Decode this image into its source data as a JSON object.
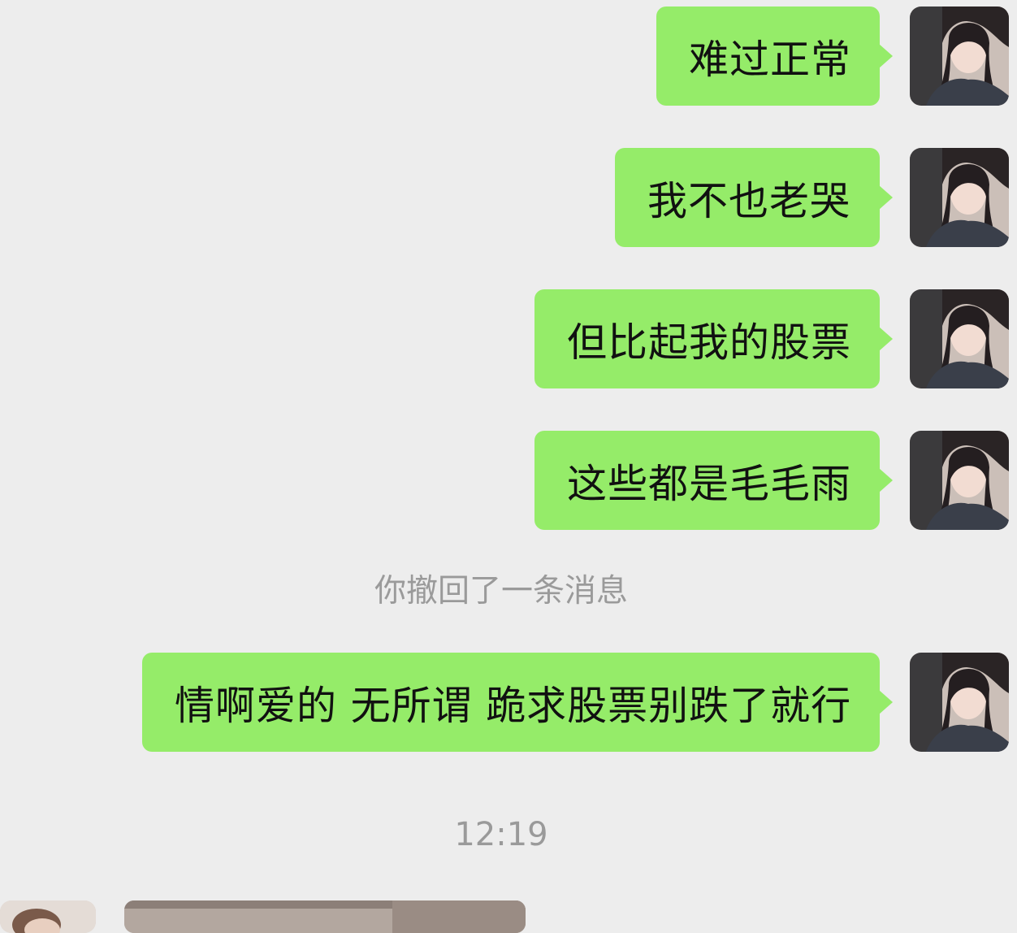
{
  "messages": [
    {
      "text": "难过正常"
    },
    {
      "text": "我不也老哭"
    },
    {
      "text": "但比起我的股票"
    },
    {
      "text": "这些都是毛毛雨"
    },
    {
      "text": "情啊爱的 无所谓 跪求股票别跌了就行"
    }
  ],
  "recall_notice": "你撤回了一条消息",
  "timestamp": "12:19",
  "colors": {
    "background": "#ededed",
    "outgoing_bubble": "#95ec69",
    "system_text": "#9a9a9a"
  }
}
